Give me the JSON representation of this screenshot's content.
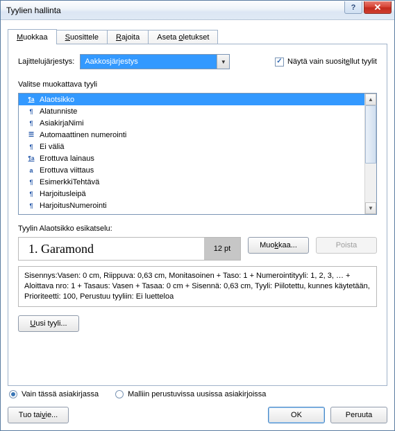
{
  "window": {
    "title": "Tyylien hallinta"
  },
  "tabs": [
    {
      "label": "Muokkaa",
      "ukey": "M",
      "active": true
    },
    {
      "label": "Suosittele",
      "ukey": "S",
      "active": false
    },
    {
      "label": "Rajoita",
      "ukey": "R",
      "active": false
    },
    {
      "label": "Aseta oletukset",
      "ukey": "o",
      "active": false
    }
  ],
  "sort": {
    "label_pre": "La",
    "label_u": "j",
    "label_post": "ittelujärjestys:",
    "value": "Aakkosjärjestys"
  },
  "show_recommended": {
    "checked": true,
    "label_pre": "Näytä vain suosit",
    "label_u": "e",
    "label_post": "llut tyylit"
  },
  "list": {
    "label": "Valitse muokattava tyyli",
    "items": [
      {
        "icon": "upara",
        "text": "Alaotsikko",
        "selected": true
      },
      {
        "icon": "para",
        "text": "Alatunniste"
      },
      {
        "icon": "para",
        "text": "AsiakirjaNimi"
      },
      {
        "icon": "list",
        "text": "Automaattinen numerointi"
      },
      {
        "icon": "para",
        "text": "Ei väliä"
      },
      {
        "icon": "upara",
        "text": "Erottuva lainaus"
      },
      {
        "icon": "char",
        "text": "Erottuva viittaus"
      },
      {
        "icon": "para",
        "text": "EsimerkkiTehtävä"
      },
      {
        "icon": "para",
        "text": "Harjoitusleipä"
      },
      {
        "icon": "para",
        "text": "HarjoitusNumerointi"
      }
    ]
  },
  "preview": {
    "label": "Tyylin Alaotsikko esikatselu:",
    "sample": "1. Garamond",
    "size": "12 pt",
    "modify_pre": "Muo",
    "modify_u": "k",
    "modify_post": "kaa...",
    "delete": "Poista"
  },
  "description": "Sisennys:Vasen:  0 cm, Riippuva:  0,63 cm, Monitasoinen + Taso: 1 + Numerointityyli: 1, 2, 3, … + Aloittava nro: 1 + Tasaus: Vasen + Tasaa:  0 cm + Sisennä:  0,63 cm, Tyyli: Piilotettu, kunnes käytetään, Prioriteetti: 100, Perustuu tyyliin: Ei luetteloa",
  "new_style_u": "U",
  "new_style_post": "usi tyyli...",
  "radios": {
    "opt1": "Vain tässä asiakirjassa",
    "opt2": "Malliin perustuvissa uusissa asiakirjoissa",
    "selected": 0
  },
  "footer": {
    "import_pre": "Tuo tai ",
    "import_u": "v",
    "import_post": "ie...",
    "ok": "OK",
    "cancel": "Peruuta"
  }
}
